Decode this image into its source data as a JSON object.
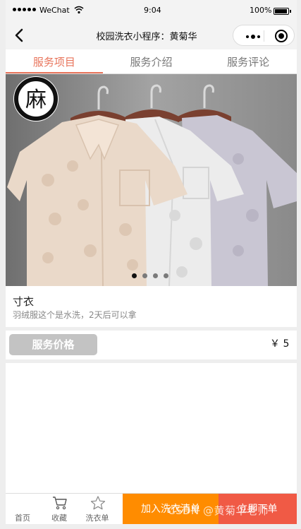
{
  "status_bar": {
    "carrier": "WeChat",
    "time": "9:04",
    "battery": "100%"
  },
  "nav": {
    "title": "校园洗衣小程序：黄菊华"
  },
  "tabs": [
    {
      "label": "服务项目",
      "active": true
    },
    {
      "label": "服务介绍",
      "active": false
    },
    {
      "label": "服务评论",
      "active": false
    }
  ],
  "banner": {
    "logo_text": "麻",
    "slides": 4,
    "current_slide": 1
  },
  "product": {
    "name": "寸衣",
    "description": "羽绒服这个是水洗，2天后可以拿"
  },
  "price": {
    "label": "服务价格",
    "value": "￥ 5"
  },
  "bottom_bar": {
    "home_label": "首页",
    "favorite_label": "收藏",
    "laundry_list_label": "洗衣单",
    "add_to_list_label": "加入洗衣清单",
    "order_now_label": "立即下单"
  },
  "watermark": "CSDN @黄菊华老师",
  "colors": {
    "accent": "#e8745b",
    "add_button": "#ff8c00",
    "order_button": "#f05a45",
    "price_label_bg": "#c3c3c3"
  }
}
